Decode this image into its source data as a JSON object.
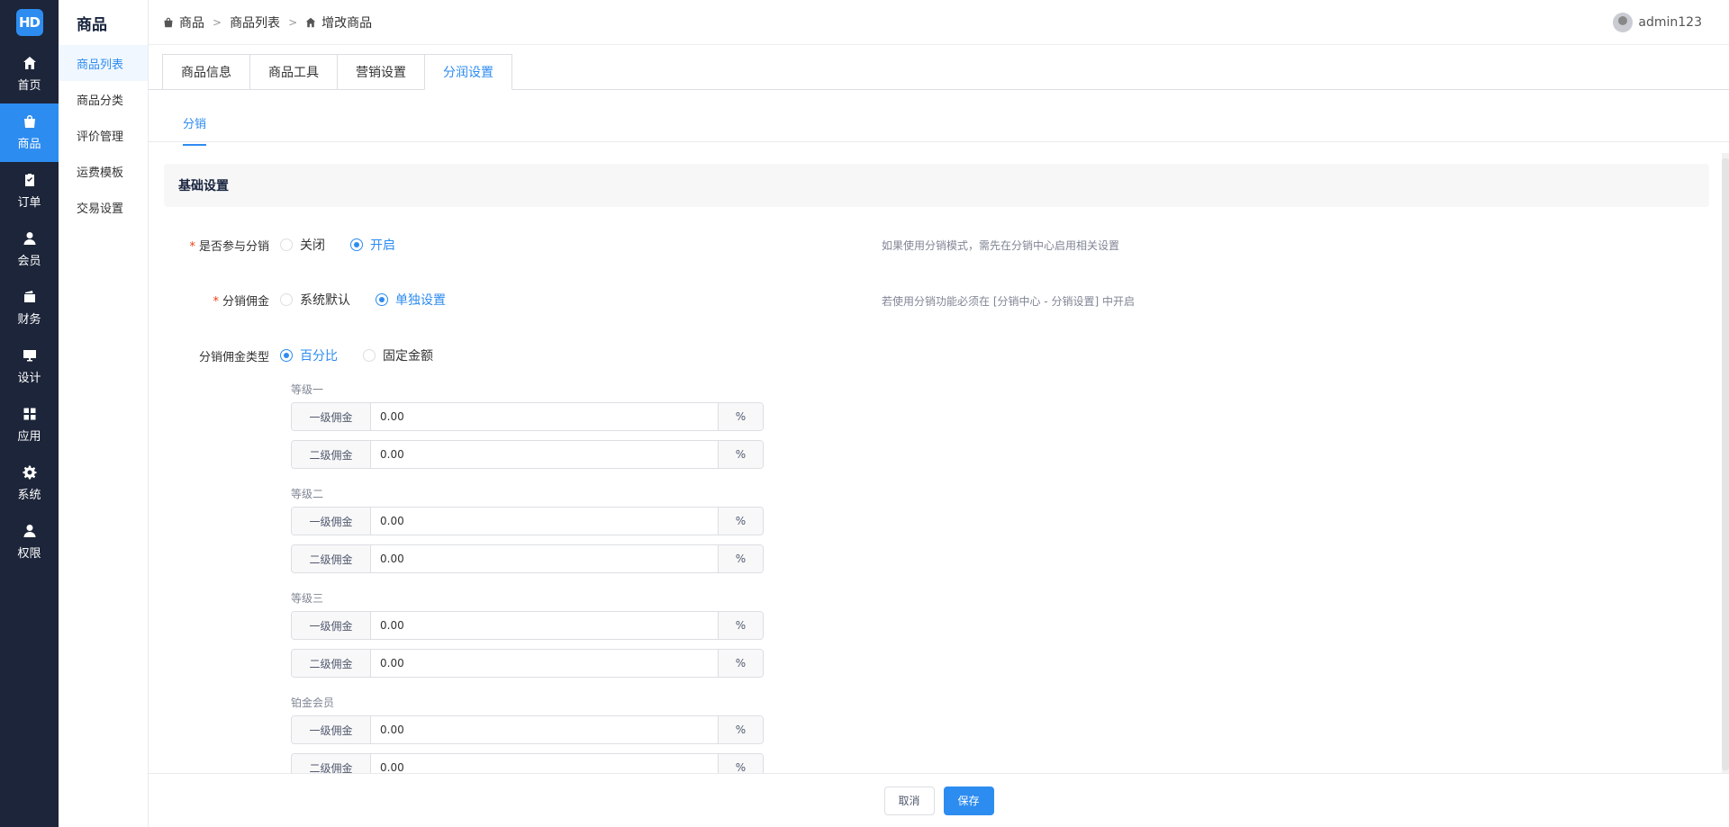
{
  "logo": {
    "text": "HD"
  },
  "nav": {
    "items": [
      {
        "label": "首页",
        "icon": "home-icon"
      },
      {
        "label": "商品",
        "icon": "bag-icon",
        "active": true
      },
      {
        "label": "订单",
        "icon": "clipboard-icon"
      },
      {
        "label": "会员",
        "icon": "user-icon"
      },
      {
        "label": "财务",
        "icon": "wallet-icon"
      },
      {
        "label": "设计",
        "icon": "monitor-icon"
      },
      {
        "label": "应用",
        "icon": "grid-icon"
      },
      {
        "label": "系统",
        "icon": "gear-icon"
      },
      {
        "label": "权限",
        "icon": "user-lock-icon"
      }
    ]
  },
  "sidebar": {
    "title": "商品",
    "items": [
      {
        "label": "商品列表",
        "active": true
      },
      {
        "label": "商品分类"
      },
      {
        "label": "评价管理"
      },
      {
        "label": "运费模板"
      },
      {
        "label": "交易设置"
      }
    ]
  },
  "breadcrumb": {
    "root": "商品",
    "list": "商品列表",
    "current": "增改商品"
  },
  "user": {
    "name": "admin123"
  },
  "tabs": [
    "商品信息",
    "商品工具",
    "营销设置",
    "分润设置"
  ],
  "subtab": "分销",
  "section": {
    "title": "基础设置"
  },
  "form": {
    "join": {
      "label": "是否参与分销",
      "off": "关闭",
      "on": "开启",
      "hint": "如果使用分销模式，需先在分销中心启用相关设置"
    },
    "commission": {
      "label": "分销佣金",
      "opt1": "系统默认",
      "opt2": "单独设置",
      "hint": "若使用分销功能必须在 [分销中心 - 分销设置] 中开启"
    },
    "type": {
      "label": "分销佣金类型",
      "opt1": "百分比",
      "opt2": "固定金额"
    },
    "levels": [
      {
        "name": "等级一",
        "first_label": "一级佣金",
        "first": "0.00",
        "second_label": "二级佣金",
        "second": "0.00",
        "unit": "%"
      },
      {
        "name": "等级二",
        "first_label": "一级佣金",
        "first": "0.00",
        "second_label": "二级佣金",
        "second": "0.00",
        "unit": "%"
      },
      {
        "name": "等级三",
        "first_label": "一级佣金",
        "first": "0.00",
        "second_label": "二级佣金",
        "second": "0.00",
        "unit": "%"
      },
      {
        "name": "铂金会员",
        "first_label": "一级佣金",
        "first": "0.00",
        "second_label": "二级佣金",
        "second": "0.00",
        "unit": "%"
      }
    ]
  },
  "footer": {
    "cancel": "取消",
    "save": "保存"
  },
  "colors": {
    "primary": "#2d8cf0",
    "nav_bg": "#1c2539",
    "required": "#ed4014"
  }
}
